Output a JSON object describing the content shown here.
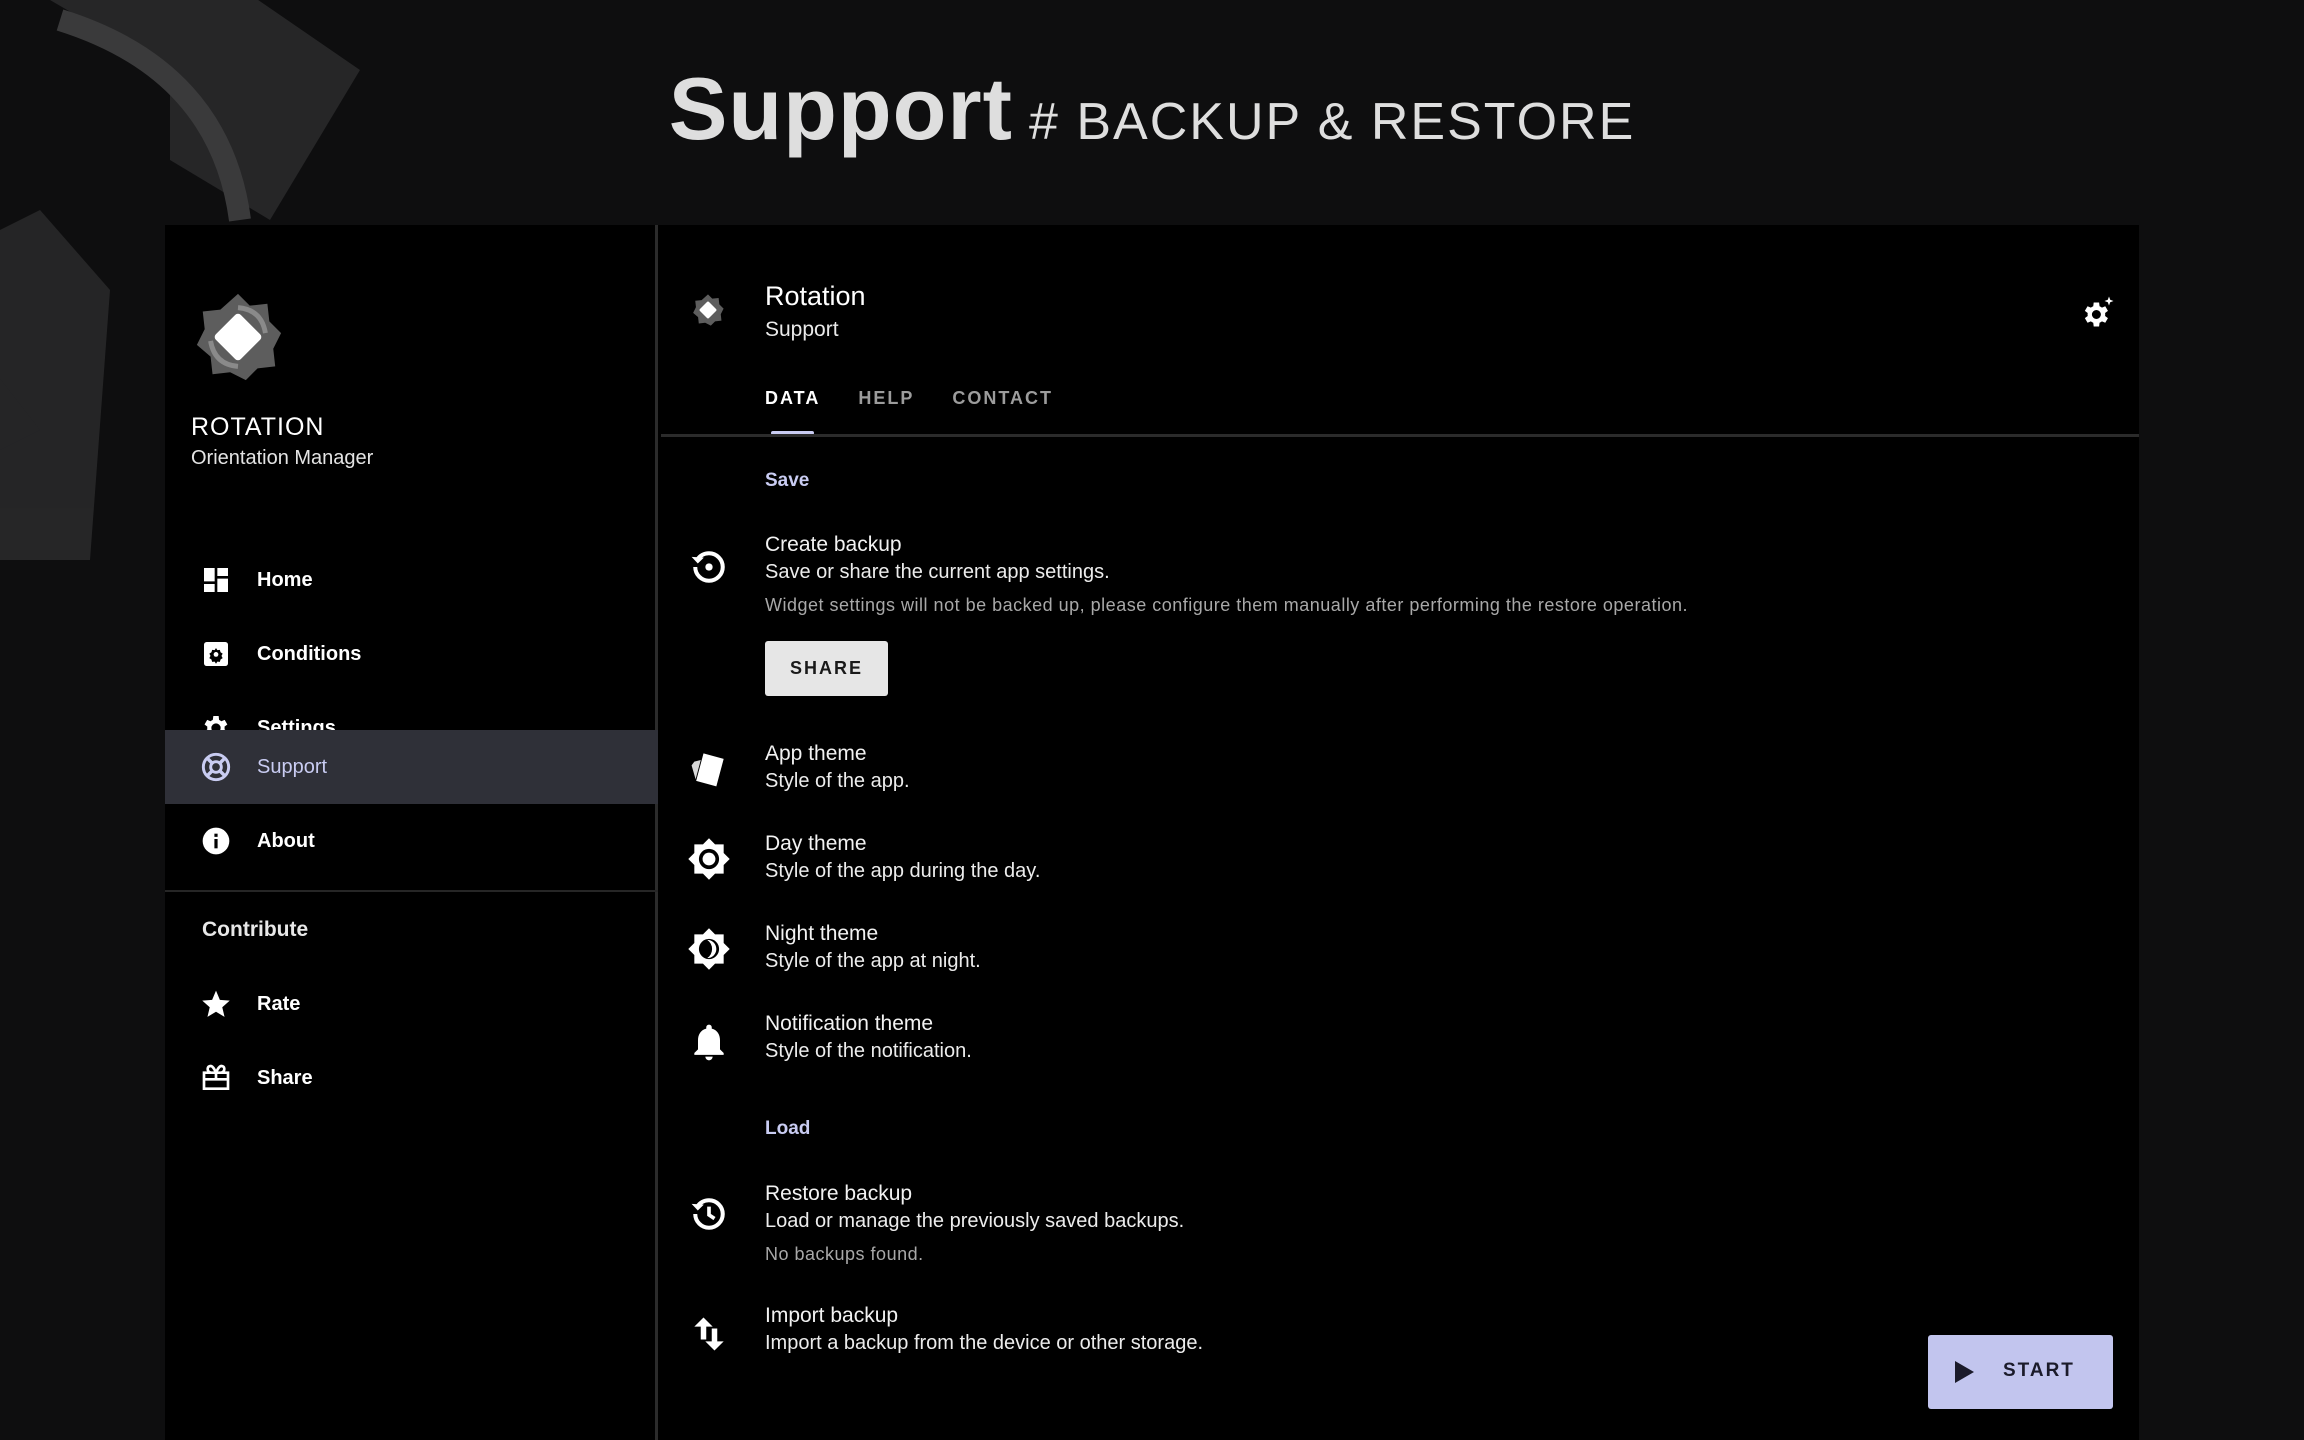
{
  "page_heading": {
    "title": "Support",
    "subtitle": "# BACKUP & RESTORE"
  },
  "sidebar": {
    "app_name": "ROTATION",
    "app_tagline": "Orientation Manager",
    "items": [
      {
        "label": "Home",
        "icon": "dashboard-icon"
      },
      {
        "label": "Conditions",
        "icon": "conditions-icon"
      },
      {
        "label": "Settings",
        "icon": "gear-icon"
      },
      {
        "label": "Support",
        "icon": "lifebuoy-icon",
        "active": true
      },
      {
        "label": "About",
        "icon": "info-icon"
      }
    ],
    "section_label": "Contribute",
    "contribute_items": [
      {
        "label": "Rate",
        "icon": "star-icon"
      },
      {
        "label": "Share",
        "icon": "gift-icon"
      }
    ]
  },
  "header": {
    "title": "Rotation",
    "subtitle": "Support"
  },
  "tabs": [
    {
      "label": "DATA",
      "active": true
    },
    {
      "label": "HELP"
    },
    {
      "label": "CONTACT"
    }
  ],
  "save_section": {
    "label": "Save",
    "create_backup": {
      "title": "Create backup",
      "desc": "Save or share the current app settings.",
      "note": "Widget settings will not be backed up, please configure them manually after performing the restore operation.",
      "button": "SHARE"
    },
    "app_theme": {
      "title": "App theme",
      "desc": "Style of the app."
    },
    "day_theme": {
      "title": "Day theme",
      "desc": "Style of the app during the day."
    },
    "night_theme": {
      "title": "Night theme",
      "desc": "Style of the app at night."
    },
    "notification_theme": {
      "title": "Notification theme",
      "desc": "Style of the notification."
    }
  },
  "load_section": {
    "label": "Load",
    "restore_backup": {
      "title": "Restore backup",
      "desc": "Load or manage the previously saved backups.",
      "note": "No backups found."
    },
    "import_backup": {
      "title": "Import backup",
      "desc": "Import a backup from the device or other storage."
    }
  },
  "fab": {
    "label": "START",
    "icon": "play-icon"
  },
  "colors": {
    "accent": "#c9ccf2",
    "fab": "#c2c5ee",
    "active_nav": "#2f3038",
    "background": "#0e0e0f"
  }
}
